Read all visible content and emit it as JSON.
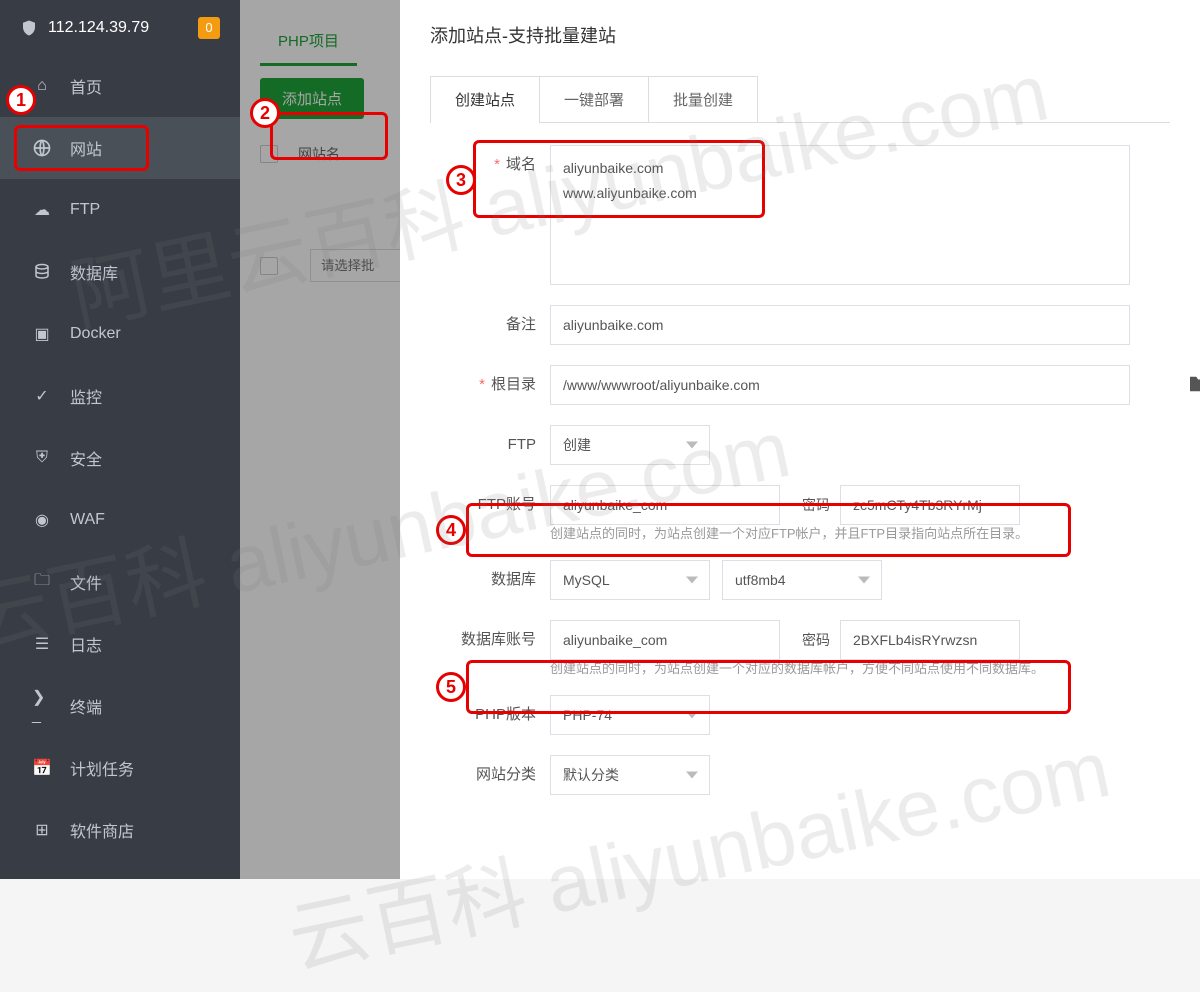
{
  "ip": "112.124.39.79",
  "badge": "0",
  "sidebar": {
    "items": [
      {
        "label": "首页"
      },
      {
        "label": "网站"
      },
      {
        "label": "FTP"
      },
      {
        "label": "数据库"
      },
      {
        "label": "Docker"
      },
      {
        "label": "监控"
      },
      {
        "label": "安全"
      },
      {
        "label": "WAF"
      },
      {
        "label": "文件"
      },
      {
        "label": "日志"
      },
      {
        "label": "终端"
      },
      {
        "label": "计划任务"
      },
      {
        "label": "软件商店"
      }
    ]
  },
  "content": {
    "tab_php": "PHP项目",
    "add_site_btn": "添加站点",
    "col_sitename": "网站名",
    "pager_placeholder": "请选择批"
  },
  "modal": {
    "title": "添加站点-支持批量建站",
    "tabs": [
      "创建站点",
      "一键部署",
      "批量创建"
    ],
    "labels": {
      "domain": "域名",
      "remark": "备注",
      "root": "根目录",
      "ftp": "FTP",
      "ftp_user": "FTP账号",
      "pwd": "密码",
      "db": "数据库",
      "db_user": "数据库账号",
      "php": "PHP版本",
      "category": "网站分类"
    },
    "values": {
      "domain": "aliyunbaike.com\nwww.aliyunbaike.com",
      "remark": "aliyunbaike.com",
      "root": "/www/wwwroot/aliyunbaike.com",
      "ftp_sel": "创建",
      "ftp_user": "aliyunbaike_com",
      "ftp_pwd": "zc5mCTy4Tb3RYrMj",
      "ftp_hint": "创建站点的同时，为站点创建一个对应FTP帐户，并且FTP目录指向站点所在目录。",
      "db_sel": "MySQL",
      "db_charset": "utf8mb4",
      "db_user": "aliyunbaike_com",
      "db_pwd": "2BXFLb4isRYrwzsn",
      "db_hint": "创建站点的同时，为站点创建一个对应的数据库帐户，方便不同站点使用不同数据库。",
      "php_sel": "PHP-74",
      "cat_sel": "默认分类"
    }
  },
  "watermarks": [
    "阿里云百科 aliyunbaike.com",
    "云百科 aliyunbaike.com",
    "云百科 aliyunbaike.com"
  ]
}
